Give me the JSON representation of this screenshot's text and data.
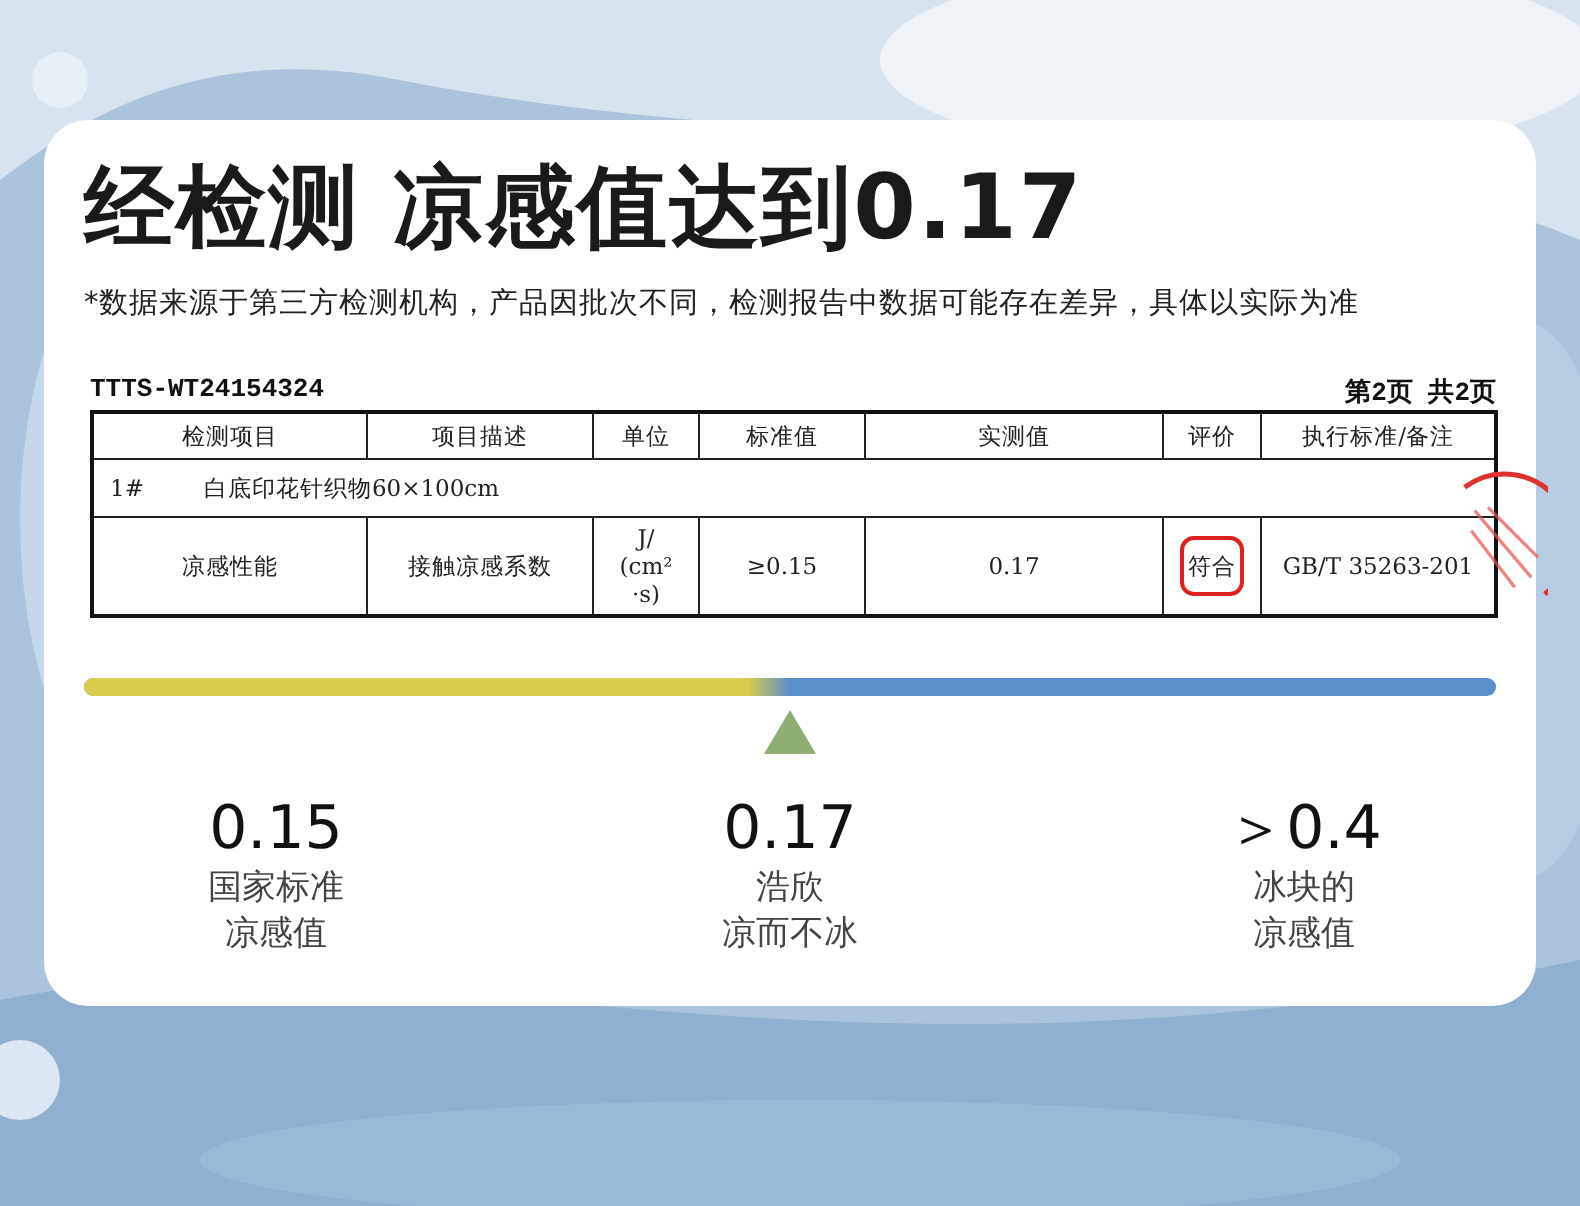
{
  "headline": "经检测 凉感值达到0.17",
  "note": "*数据来源于第三方检测机构，产品因批次不同，检测报告中数据可能存在差异，具体以实际为准",
  "report": {
    "number": "TTTS-WT24154324",
    "page": "第2页  共2页",
    "columns": [
      "检测项目",
      "项目描述",
      "单位",
      "标准值",
      "实测值",
      "评价",
      "执行标准/备注"
    ],
    "sample": {
      "index": "1#",
      "name": "白底印花针织物60×100cm"
    },
    "rows": [
      {
        "cells": [
          {
            "lines": [
              "凉感性能"
            ],
            "circled": false
          },
          {
            "lines": [
              "接触凉感系数"
            ],
            "circled": false
          },
          {
            "lines": [
              "J/",
              "(cm²",
              "·s)"
            ],
            "circled": false
          },
          {
            "lines": [
              "≥0.15"
            ],
            "circled": false
          },
          {
            "lines": [
              "0.17"
            ],
            "circled": false
          },
          {
            "lines": [
              "符合"
            ],
            "circled": true
          },
          {
            "lines": [
              "GB/T 35263-201"
            ],
            "circled": false
          }
        ]
      }
    ]
  },
  "scale": {
    "level": 0.5,
    "points": [
      {
        "value": "0.15",
        "label": [
          "国家标准",
          "凉感值"
        ]
      },
      {
        "value": "0.17",
        "label": [
          "浩欣",
          "凉而不冰"
        ]
      },
      {
        "value": "＞0.4",
        "label": [
          "冰块的",
          "凉感值"
        ]
      }
    ]
  }
}
